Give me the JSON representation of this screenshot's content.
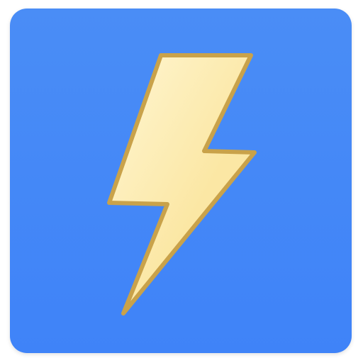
{
  "app_icon": {
    "icon": "lightning-bolt-icon",
    "colors": {
      "background_top": "#4a8df6",
      "background_bottom": "#3f83f8",
      "bolt_fill": "#fbe7a4",
      "bolt_highlight": "#fff6d2",
      "bolt_outline": "#c9a24a"
    }
  }
}
